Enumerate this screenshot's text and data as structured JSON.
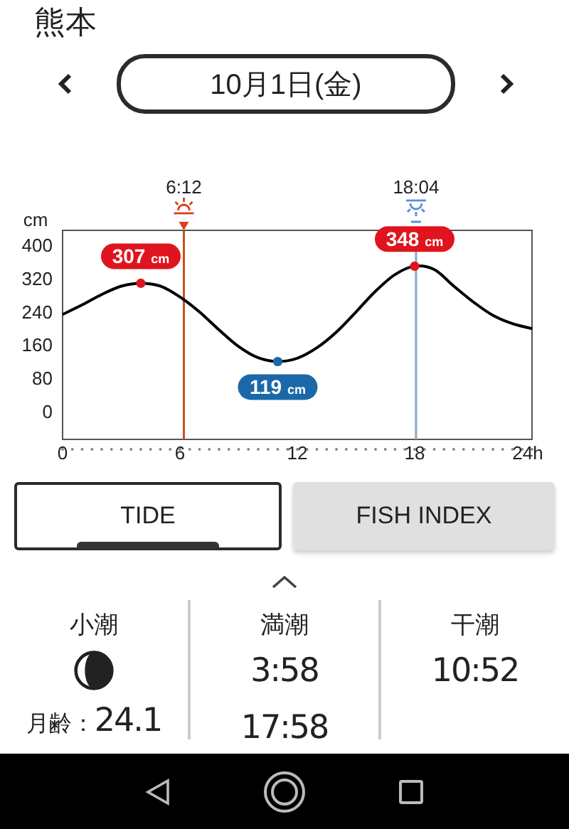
{
  "location": "熊本",
  "date_nav": {
    "date": "10月1日(金)"
  },
  "tide_chart": {
    "y_unit": "cm",
    "sun_events": [
      {
        "kind": "sunrise",
        "time": "6:12"
      },
      {
        "kind": "sunset",
        "time": "18:04"
      }
    ],
    "extreme_labels": [
      {
        "value": "307",
        "unit": "cm"
      },
      {
        "value": "119",
        "unit": "cm"
      },
      {
        "value": "348",
        "unit": "cm"
      }
    ],
    "chart_data": {
      "type": "line",
      "x": [
        0,
        1,
        2,
        3,
        4,
        5,
        6,
        7,
        8,
        9,
        10,
        11,
        12,
        13,
        14,
        15,
        16,
        17,
        18,
        19,
        20,
        21,
        22,
        23,
        24
      ],
      "series": [
        {
          "color": "#000000",
          "values": [
            232,
            255,
            280,
            300,
            307,
            300,
            274,
            238,
            195,
            155,
            128,
            119,
            127,
            152,
            190,
            238,
            288,
            328,
            348,
            340,
            300,
            262,
            230,
            210,
            198
          ]
        }
      ],
      "xlim": [
        0,
        24
      ],
      "ylim": [
        -68,
        434
      ],
      "xticks": [
        0,
        6,
        12,
        18,
        {
          "value": 24,
          "label": "24h"
        }
      ],
      "yticks": [
        0,
        80,
        160,
        240,
        320,
        400
      ],
      "ref_lines": [
        {
          "axis": "x",
          "value": 6.2,
          "color": "#c8501e"
        },
        {
          "axis": "x",
          "value": 18.07,
          "color": "#8aa6c8"
        }
      ]
    }
  },
  "tabs": [
    {
      "label": "TIDE",
      "selected": true
    },
    {
      "label": "FISH INDEX",
      "selected": false
    }
  ],
  "summary": {
    "tide_type": "小潮",
    "moon_age_label": "月齢：",
    "moon_age": "24.1",
    "columns": [
      {
        "title": "満潮",
        "times": [
          "3:58",
          "17:58"
        ]
      },
      {
        "title": "干潮",
        "times": [
          "10:52"
        ]
      }
    ]
  }
}
